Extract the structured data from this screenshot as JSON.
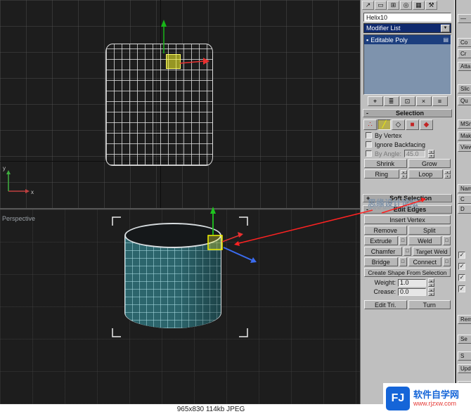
{
  "status_bar": {
    "text": "965x830  114kb  JPEG"
  },
  "viewport": {
    "perspective_label": "Perspective",
    "axis_x_label": "x",
    "axis_y_label": "y"
  },
  "watermark": {
    "main": "思缘设计论坛",
    "sub": "WWW.MISSYUAN.COM"
  },
  "logo": {
    "initials": "FJ",
    "title": "软件自学网",
    "url": "www.rjzxw.com"
  },
  "ui": {
    "spin_up": "▴",
    "spin_down": "▾",
    "dropdown_arrow": "▼",
    "check": "✓"
  },
  "panel": {
    "tabs": [
      {
        "name": "create-tab",
        "glyph": "↗"
      },
      {
        "name": "modify-tab",
        "glyph": "▭"
      },
      {
        "name": "hierarchy-tab",
        "glyph": "⊞"
      },
      {
        "name": "motion-tab",
        "glyph": "◎"
      },
      {
        "name": "display-tab",
        "glyph": "▦"
      },
      {
        "name": "utilities-tab",
        "glyph": "⚒"
      }
    ],
    "object_name": "Helix10",
    "modifier_list_label": "Modifier List",
    "stack": {
      "selected_item": "Editable Poly",
      "item_icon": "▪",
      "right_icon": "▤"
    },
    "stack_tools": [
      {
        "name": "pin-stack-button",
        "glyph": "⌖"
      },
      {
        "name": "show-end-result-button",
        "glyph": "≣"
      },
      {
        "name": "make-unique-button",
        "glyph": "⊡"
      },
      {
        "name": "remove-modifier-button",
        "glyph": "×"
      },
      {
        "name": "configure-modifier-sets-button",
        "glyph": "≡"
      }
    ],
    "selection": {
      "title": "Selection",
      "collapse_glyph": "-",
      "subobject": [
        {
          "name": "vertex-mode-button",
          "glyph": "∴"
        },
        {
          "name": "edge-mode-button",
          "glyph": "╱"
        },
        {
          "name": "border-mode-button",
          "glyph": "◇"
        },
        {
          "name": "polygon-mode-button",
          "glyph": "■"
        },
        {
          "name": "element-mode-button",
          "glyph": "◆"
        }
      ],
      "by_vertex": "By Vertex",
      "ignore_backfacing": "Ignore Backfacing",
      "by_angle": "By Angle:",
      "by_angle_value": "45.0",
      "shrink": "Shrink",
      "grow": "Grow",
      "ring": "Ring",
      "loop": "Loop"
    },
    "soft_selection": {
      "title": "Soft Selection",
      "expand_glyph": "+"
    },
    "edit_edges": {
      "title": "Edit Edges",
      "collapse_glyph": "-",
      "insert_vertex": "Insert Vertex",
      "remove": "Remove",
      "split": "Split",
      "extrude": "Extrude",
      "weld": "Weld",
      "chamfer": "Chamfer",
      "target_weld": "Target Weld",
      "bridge": "Bridge",
      "connect": "Connect",
      "settings_glyph": "□",
      "create_shape": "Create Shape From Selection",
      "weight_label": "Weight:",
      "weight_value": "1.0",
      "crease_label": "Crease:",
      "crease_value": "0.0",
      "edit_tri": "Edit Tri.",
      "turn": "Turn"
    }
  },
  "strip": {
    "check_glyph": "✓",
    "items": [
      {
        "label": "—"
      },
      {
        "label": "Co"
      },
      {
        "label": "Cr"
      },
      {
        "label": "Atta"
      },
      {
        "label": "Slic"
      },
      {
        "label": "Qu"
      },
      {
        "label": "MSm"
      },
      {
        "label": "Mak"
      },
      {
        "label": "View"
      },
      {
        "label": "Nam"
      },
      {
        "label": "C"
      },
      {
        "label": "D"
      },
      {
        "label": "Rem"
      },
      {
        "label": "Se"
      },
      {
        "label": "S"
      },
      {
        "label": "Upd"
      },
      {
        "label": "V"
      }
    ]
  }
}
